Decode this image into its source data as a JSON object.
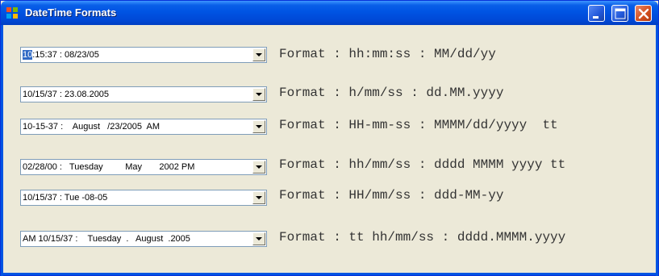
{
  "window": {
    "title": "DateTime Formats",
    "icon": "app-window-icon",
    "controls": [
      "minimize-icon",
      "maximize-icon",
      "close-icon"
    ]
  },
  "rows": [
    {
      "picker_selected": "10",
      "picker_rest": ":15:37 : 08/23/05",
      "format": "Format : hh:mm:ss : MM/dd/yy"
    },
    {
      "picker_selected": "",
      "picker_rest": "10/15/37 : 23.08.2005",
      "format": "Format : h/mm/ss : dd.MM.yyyy"
    },
    {
      "picker_selected": "",
      "picker_rest": "10-15-37 :    August   /23/2005  AM",
      "format": "Format : HH-mm-ss : MMMM/dd/yyyy  tt"
    },
    {
      "picker_selected": "",
      "picker_rest": "02/28/00 :   Tuesday         May       2002 PM",
      "format": "Format : hh/mm/ss : dddd MMMM yyyy tt"
    },
    {
      "picker_selected": "",
      "picker_rest": "10/15/37 : Tue -08-05",
      "format": "Format : HH/mm/ss : ddd-MM-yy"
    },
    {
      "picker_selected": "",
      "picker_rest": "AM 10/15/37 :    Tuesday  .   August  .2005",
      "format": "Format : tt hh/mm/ss : dddd.MMMM.yyyy"
    }
  ],
  "colors": {
    "titlebar": "#0054e3",
    "face": "#ece9d8",
    "selection": "#316ac5",
    "border": "#7f9db9"
  }
}
